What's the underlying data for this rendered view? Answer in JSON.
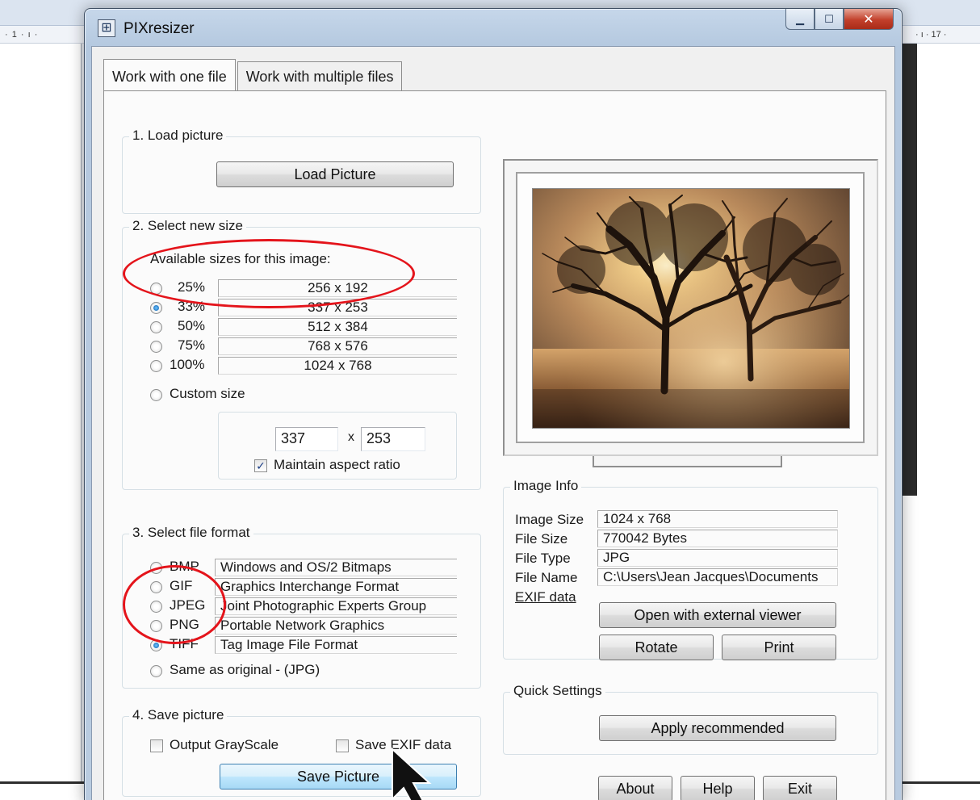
{
  "background": {
    "ruler_left": "· 1 · ı ·",
    "ruler_right": "· ı · 17 ·"
  },
  "window": {
    "title": "PIXresizer",
    "app_icon": "grid-logo-icon",
    "controls": {
      "minimize": "minimize-icon",
      "maximize": "maximize-icon",
      "close": "close-icon"
    }
  },
  "tabs": [
    {
      "label": "Work with one file",
      "active": true
    },
    {
      "label": "Work with multiple files",
      "active": false
    }
  ],
  "load": {
    "title": "1. Load picture",
    "button": "Load Picture"
  },
  "size": {
    "title": "2. Select new size",
    "available_label": "Available sizes for this image:",
    "options": [
      {
        "percent": "25%",
        "dims": "256 x 192",
        "selected": false
      },
      {
        "percent": "33%",
        "dims": "337 x 253",
        "selected": true
      },
      {
        "percent": "50%",
        "dims": "512 x 384",
        "selected": false
      },
      {
        "percent": "75%",
        "dims": "768 x 576",
        "selected": false
      },
      {
        "percent": "100%",
        "dims": "1024 x 768",
        "selected": false
      }
    ],
    "custom_label": "Custom size",
    "custom_width": "337",
    "times": "x",
    "custom_height": "253",
    "maintain_label": "Maintain aspect ratio",
    "maintain_checked": true
  },
  "format": {
    "title": "3. Select file format",
    "options": [
      {
        "code": "BMP",
        "desc": "Windows and OS/2 Bitmaps",
        "selected": false
      },
      {
        "code": "GIF",
        "desc": "Graphics Interchange Format",
        "selected": false
      },
      {
        "code": "JPEG",
        "desc": "Joint Photographic Experts Group",
        "selected": false
      },
      {
        "code": "PNG",
        "desc": "Portable Network Graphics",
        "selected": false
      },
      {
        "code": "TIFF",
        "desc": "Tag Image File Format",
        "selected": true
      }
    ],
    "same_label": "Same as original  - (JPG)"
  },
  "save": {
    "title": "4. Save picture",
    "grayscale_label": "Output GrayScale",
    "exif_label": "Save EXIF data",
    "button": "Save Picture"
  },
  "image_info": {
    "title": "Image Info",
    "rows": [
      {
        "label": "Image Size",
        "value": "1024 x 768"
      },
      {
        "label": "File Size",
        "value": "770042 Bytes"
      },
      {
        "label": "File Type",
        "value": "JPG"
      },
      {
        "label": "File Name",
        "value": "C:\\Users\\Jean Jacques\\Documents"
      }
    ],
    "exif_link": "EXIF data",
    "open_button": "Open with external viewer",
    "rotate_button": "Rotate",
    "print_button": "Print"
  },
  "quick": {
    "title": "Quick Settings",
    "button": "Apply recommended"
  },
  "footer": {
    "about": "About",
    "help": "Help",
    "exit": "Exit"
  },
  "colors": {
    "annotation": "#e4141b",
    "selected_radio": "#1466b4",
    "save_button_highlight": "#bee6fd"
  }
}
